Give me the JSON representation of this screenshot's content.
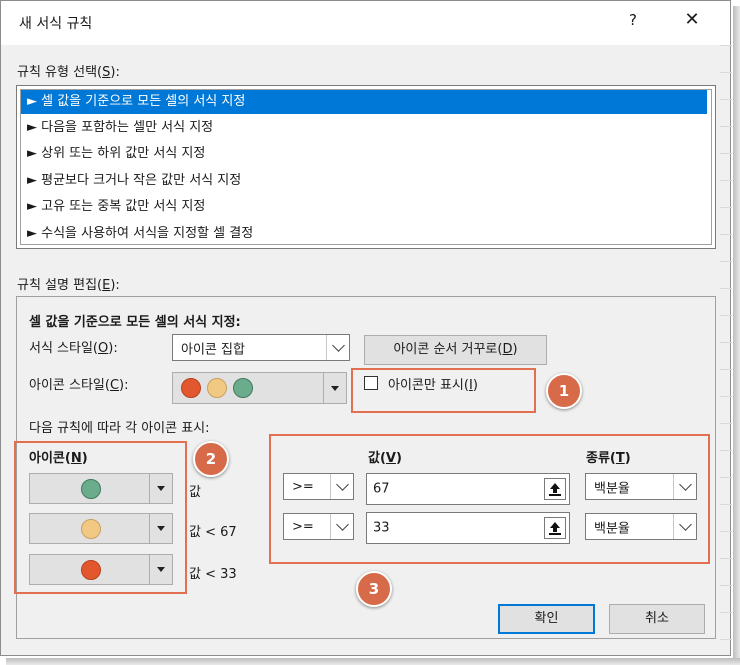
{
  "dialog": {
    "title": "새 서식 규칙",
    "help": "?",
    "close": "✕"
  },
  "rule_type": {
    "label_pre": "규칙 유형 선택(",
    "label_key": "S",
    "label_post": "):",
    "items": [
      "► 셀 값을 기준으로 모든 셀의 서식 지정",
      "► 다음을 포함하는 셀만 서식 지정",
      "► 상위 또는 하위 값만 서식 지정",
      "► 평균보다 크거나 작은 값만 서식 지정",
      "► 고유 또는 중복 값만 서식 지정",
      "► 수식을 사용하여 서식을 지정할 셀 결정"
    ],
    "selected_index": 0
  },
  "rule_edit": {
    "label_pre": "규칙 설명 편집(",
    "label_key": "E",
    "label_post": "):",
    "heading": "셀 값을 기준으로 모든 셀의 서식 지정:",
    "format_style_pre": "서식 스타일(",
    "format_style_key": "O",
    "format_style_post": "):",
    "format_style_value": "아이콘 집합",
    "reverse_btn_pre": "아이콘 순서 거꾸로(",
    "reverse_btn_key": "D",
    "reverse_btn_post": ")",
    "icon_style_pre": "아이콘 스타일(",
    "icon_style_key": "C",
    "icon_style_post": "):",
    "icon_only_pre": "아이콘만 표시(",
    "icon_only_key": "I",
    "icon_only_post": ")",
    "icon_only_checked": false,
    "rule_caption": "다음 규칙에 따라 각 아이콘 표시:",
    "icon_header_pre": "아이콘(",
    "icon_header_key": "N",
    "icon_header_post": ")",
    "value_header_pre": "값(",
    "value_header_key": "V",
    "value_header_post": ")",
    "type_header_pre": "종류(",
    "type_header_key": "T",
    "type_header_post": ")",
    "rows": [
      {
        "icon": "green-circle-icon",
        "condition": "값",
        "operator": ">=",
        "value": "67",
        "type": "백분율"
      },
      {
        "icon": "yellow-circle-icon",
        "condition": "값 < 67",
        "operator": ">=",
        "value": "33",
        "type": "백분율"
      },
      {
        "icon": "red-circle-icon",
        "condition": "값 < 33"
      }
    ]
  },
  "buttons": {
    "ok": "확인",
    "cancel": "취소"
  },
  "annotations": [
    "1",
    "2",
    "3"
  ],
  "colors": {
    "selection": "#0078d7",
    "annotation": "#d76a48",
    "red_icon": "#e2572d",
    "yellow_icon": "#f2c983",
    "green_icon": "#6bac8c"
  }
}
